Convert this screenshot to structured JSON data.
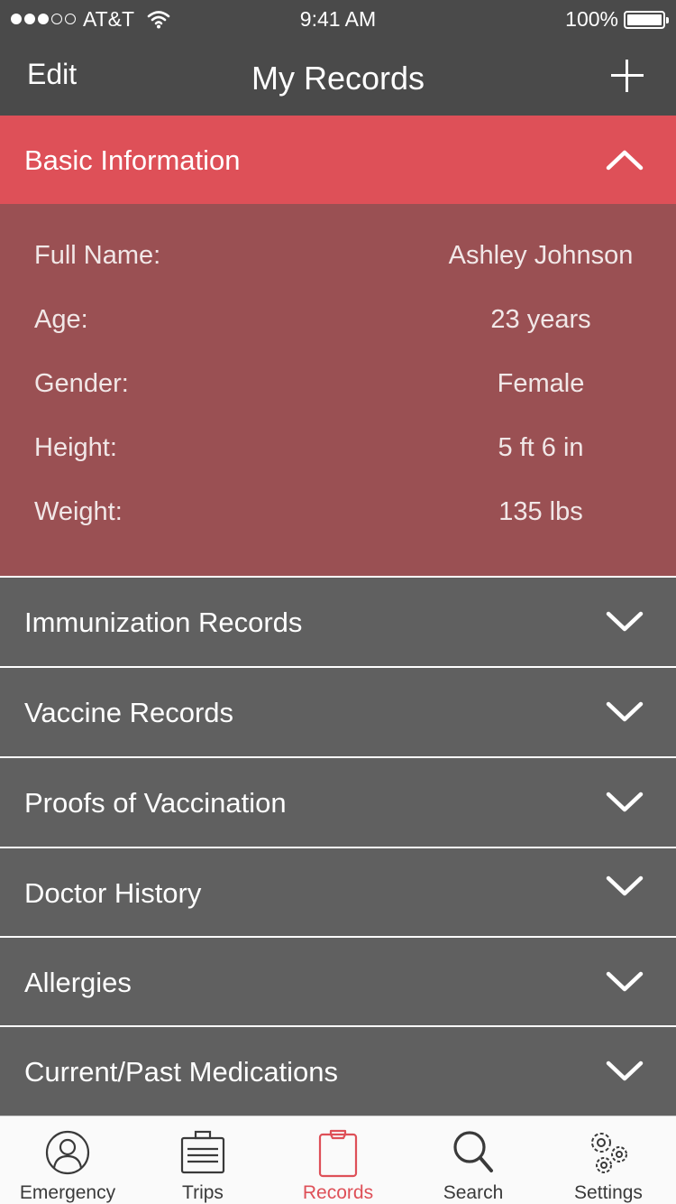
{
  "status_bar": {
    "carrier": "AT&T",
    "time": "9:41 AM",
    "battery": "100%",
    "signal_bars_filled": 3,
    "signal_bars_total": 5
  },
  "nav": {
    "edit_label": "Edit",
    "title": "My Records",
    "add_icon": "plus-icon"
  },
  "basic_info": {
    "title": "Basic Information",
    "expanded": true,
    "fields": [
      {
        "label": "Full Name:",
        "value": "Ashley Johnson"
      },
      {
        "label": "Age:",
        "value": "23 years"
      },
      {
        "label": "Gender:",
        "value": "Female"
      },
      {
        "label": "Height:",
        "value": "5 ft 6 in"
      },
      {
        "label": "Weight:",
        "value": "135 lbs"
      }
    ]
  },
  "sections": [
    {
      "title": "Immunization Records"
    },
    {
      "title": "Vaccine Records"
    },
    {
      "title": "Proofs of Vaccination"
    },
    {
      "title": "Doctor History"
    },
    {
      "title": "Allergies"
    },
    {
      "title": "Current/Past Medications"
    }
  ],
  "tabs": [
    {
      "label": "Emergency",
      "icon": "person-icon"
    },
    {
      "label": "Trips",
      "icon": "suitcase-icon"
    },
    {
      "label": "Records",
      "icon": "clipboard-icon"
    },
    {
      "label": "Search",
      "icon": "search-icon"
    },
    {
      "label": "Settings",
      "icon": "gear-icon"
    }
  ],
  "active_tab": "Records",
  "colors": {
    "bar_background": "#4a4a4a",
    "accent": "#de5058",
    "expanded_body": "#9a5053",
    "section_background": "#606060"
  }
}
